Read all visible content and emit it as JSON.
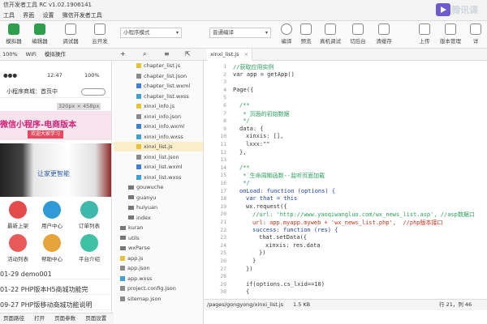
{
  "app": {
    "title": "信开发者工具 RC v1.02.1906141"
  },
  "menu": [
    "工具",
    "界面",
    "设置",
    "微信开发者工具"
  ],
  "toolbar": {
    "left_buttons": [
      "模拟器",
      "编辑器",
      "调试器",
      "云开发"
    ],
    "mode_select": "小程序模式",
    "compile_select": "普通编译",
    "right_buttons": [
      "编译",
      "预览",
      "真机调试",
      "切后台",
      "清缓存",
      "上传",
      "版本管理",
      "详"
    ]
  },
  "watermark": {
    "text": "腾讯课"
  },
  "simulator": {
    "bar": [
      "100%",
      "WiFi",
      "模拟操作"
    ],
    "status_time": "12:47",
    "status_battery": "100%",
    "nav_title": "小程序商城：首页中",
    "banner_title": "微信小程序-电商版本",
    "banner_sub": "欢迎大家学习",
    "size_badge": "320px × 458px",
    "banner_blue": "让家更智能",
    "grid": [
      {
        "label": "最新上架",
        "color": "#e64b4b"
      },
      {
        "label": "用户中心",
        "color": "#2f9ad6"
      },
      {
        "label": "订单列表",
        "color": "#3fb8ac"
      },
      {
        "label": "活动列表",
        "color": "#e85a5a"
      },
      {
        "label": "帮助中心",
        "color": "#e8a23a"
      },
      {
        "label": "平台介绍",
        "color": "#3fc1a5"
      }
    ],
    "news": [
      "01-29 demo001",
      "01-22 PHP版本H5商城功能完",
      "09-27 PHP版移动商城功能说明"
    ],
    "tabbar": [
      "页面路径",
      "打开",
      "页面参数",
      "页面设置"
    ]
  },
  "filetree": {
    "toolbar_icons": [
      "+",
      "search-icon",
      "list-icon",
      "collapse-icon"
    ],
    "items": [
      {
        "label": "chapter_list.js",
        "type": "js",
        "indent": 1
      },
      {
        "label": "chapter_list.json",
        "type": "json",
        "indent": 1
      },
      {
        "label": "chapter_list.wxml",
        "type": "wxml",
        "indent": 1
      },
      {
        "label": "chapter_list.wxss",
        "type": "wxss",
        "indent": 1
      },
      {
        "label": "xinxi_info.js",
        "type": "js",
        "indent": 1
      },
      {
        "label": "xinxi_info.json",
        "type": "json",
        "indent": 1
      },
      {
        "label": "xinxi_info.wxml",
        "type": "wxml",
        "indent": 1
      },
      {
        "label": "xinxi_info.wxss",
        "type": "wxss",
        "indent": 1
      },
      {
        "label": "xinxi_list.js",
        "type": "js",
        "indent": 1,
        "selected": true
      },
      {
        "label": "xinxi_list.json",
        "type": "json",
        "indent": 1
      },
      {
        "label": "xinxi_list.wxml",
        "type": "wxml",
        "indent": 1
      },
      {
        "label": "xinxi_list.wxss",
        "type": "wxss",
        "indent": 1
      },
      {
        "label": "gouwuche",
        "type": "folder",
        "indent": 0
      },
      {
        "label": "guanyu",
        "type": "folder",
        "indent": 0
      },
      {
        "label": "huiyuan",
        "type": "folder",
        "indent": 0
      },
      {
        "label": "index",
        "type": "folder",
        "indent": 0
      },
      {
        "label": "kuran",
        "type": "folder",
        "indent": -1
      },
      {
        "label": "utils",
        "type": "folder",
        "indent": -1
      },
      {
        "label": "wxParse",
        "type": "folder",
        "indent": -1
      },
      {
        "label": "app.js",
        "type": "js",
        "indent": -1
      },
      {
        "label": "app.json",
        "type": "json",
        "indent": -1
      },
      {
        "label": "app.wxss",
        "type": "wxss",
        "indent": -1
      },
      {
        "label": "project.config.json",
        "type": "json",
        "indent": -1
      },
      {
        "label": "sitemap.json",
        "type": "json",
        "indent": -1
      }
    ]
  },
  "editor": {
    "tab": "xinxi_list.js",
    "lines": [
      {
        "n": 1,
        "t": "//获取应用实例",
        "c": "com",
        "i": 0
      },
      {
        "n": 2,
        "t": "var app = getApp()",
        "c": "def",
        "i": 0
      },
      {
        "n": 3,
        "t": "",
        "c": "def",
        "i": 0
      },
      {
        "n": 4,
        "t": "Page({",
        "c": "def",
        "i": 0
      },
      {
        "n": 5,
        "t": "",
        "c": "def",
        "i": 0
      },
      {
        "n": 6,
        "t": "/**",
        "c": "com",
        "i": 1
      },
      {
        "n": 7,
        "t": " * 页面的初始数据",
        "c": "com",
        "i": 1
      },
      {
        "n": 8,
        "t": " */",
        "c": "com",
        "i": 1
      },
      {
        "n": 9,
        "t": "data: {",
        "c": "def",
        "i": 1
      },
      {
        "n": 10,
        "t": "xinxis: [],",
        "c": "def",
        "i": 2
      },
      {
        "n": 11,
        "t": "lxxx:\"\"",
        "c": "def",
        "i": 2
      },
      {
        "n": 12,
        "t": "},",
        "c": "def",
        "i": 1
      },
      {
        "n": 13,
        "t": "",
        "c": "def",
        "i": 0
      },
      {
        "n": 14,
        "t": "/**",
        "c": "com",
        "i": 1
      },
      {
        "n": 15,
        "t": " * 生命周期函数--监听页面加载",
        "c": "com",
        "i": 1
      },
      {
        "n": 16,
        "t": " */",
        "c": "com",
        "i": 1
      },
      {
        "n": 17,
        "t": "onLoad: function (options) {",
        "c": "kw",
        "i": 1
      },
      {
        "n": 18,
        "t": "var that = this",
        "c": "kw",
        "i": 2
      },
      {
        "n": 19,
        "t": "wx.request({",
        "c": "def",
        "i": 2
      },
      {
        "n": 20,
        "t": "//url: 'http://www.yaoqiwangluo.com/wx_news_list.asp', //asp数据口",
        "c": "com",
        "i": 3
      },
      {
        "n": 21,
        "t": "url: app.myapp.myweb + 'wx_news_list.php',  //php版本接口",
        "c": "str",
        "i": 3
      },
      {
        "n": 22,
        "t": "success: function (res) {",
        "c": "kw",
        "i": 3
      },
      {
        "n": 23,
        "t": "that.setData({",
        "c": "def",
        "i": 4
      },
      {
        "n": 24,
        "t": "xinxis: res.data",
        "c": "def",
        "i": 5
      },
      {
        "n": 25,
        "t": "})",
        "c": "def",
        "i": 4
      },
      {
        "n": 26,
        "t": "}",
        "c": "def",
        "i": 3
      },
      {
        "n": 27,
        "t": "})",
        "c": "def",
        "i": 2
      },
      {
        "n": 28,
        "t": "",
        "c": "def",
        "i": 0
      },
      {
        "n": 29,
        "t": "if(options.cs_lxid==10)",
        "c": "def",
        "i": 2
      },
      {
        "n": 30,
        "t": "{",
        "c": "def",
        "i": 2
      }
    ],
    "status_path": "/pages/gongyong/xinxi_list.js",
    "status_size": "1.5 KB",
    "status_cursor": "行 21，列 46"
  }
}
